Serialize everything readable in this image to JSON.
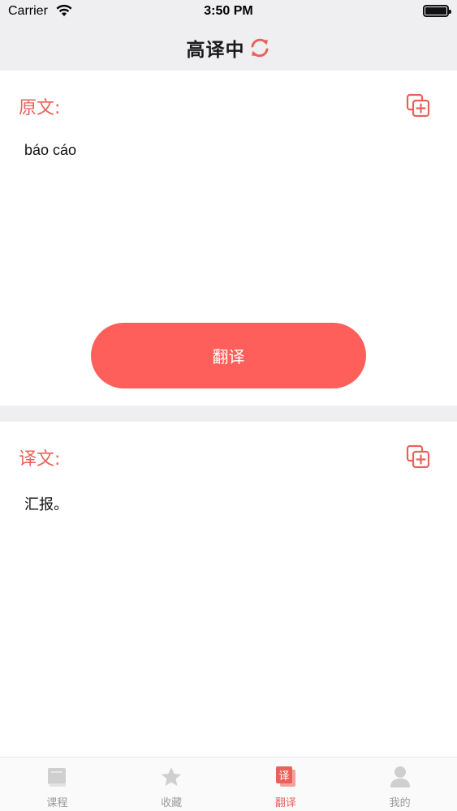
{
  "status_bar": {
    "carrier": "Carrier",
    "time": "3:50 PM"
  },
  "nav": {
    "title": "高译中",
    "refresh_icon": "refresh-icon"
  },
  "source": {
    "label": "原文:",
    "text": "báo cáo",
    "copy_icon": "copy-add-icon"
  },
  "translate_button": {
    "label": "翻译"
  },
  "target": {
    "label": "译文:",
    "text": "汇报。",
    "copy_icon": "copy-add-icon"
  },
  "tabs": [
    {
      "label": "课程",
      "icon": "book-icon",
      "active": false
    },
    {
      "label": "收藏",
      "icon": "star-icon",
      "active": false
    },
    {
      "label": "翻译",
      "icon": "translate-icon",
      "active": true
    },
    {
      "label": "我的",
      "icon": "person-icon",
      "active": false
    }
  ],
  "colors": {
    "accent": "#e8625c",
    "button": "#fe5f5a",
    "background": "#efeff1",
    "tab_inactive": "#9a9a9a"
  }
}
